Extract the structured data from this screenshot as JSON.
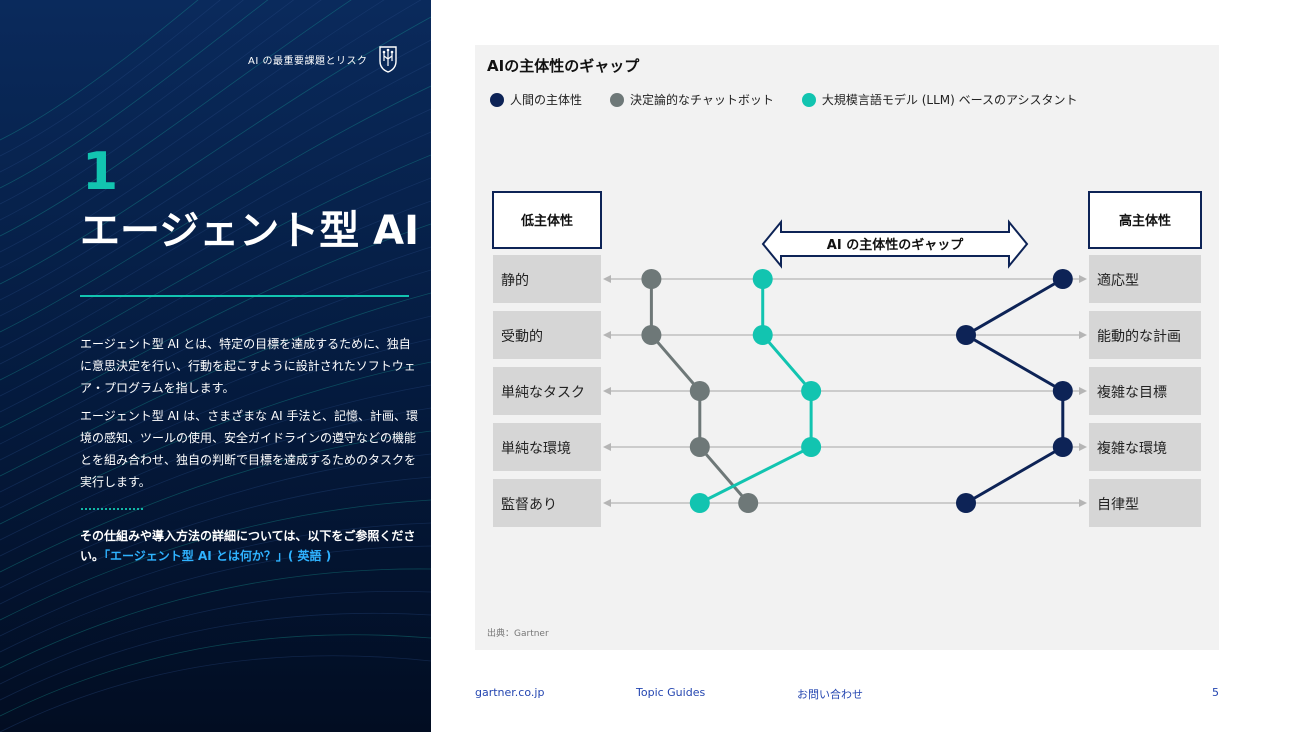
{
  "header": {
    "subtitle": "AI の最重要課題とリスク",
    "logo_icon": "shield-circuit-icon"
  },
  "section": {
    "number": "1",
    "title": "エージェント型 AI",
    "paragraph1": "エージェント型 AI とは、特定の目標を達成するために、独自に意思決定を行い、行動を起こすように設計されたソフトウェア・プログラムを指します。",
    "paragraph2": "エージェント型 AI は、さまざまな AI 手法と、記憶、計画、環境の感知、ツールの使用、安全ガイドラインの遵守などの機能とを組み合わせ、独自の判断で目標を達成するためのタスクを実行します。",
    "cta_text": "その仕組みや導入方法の詳細については、以下をご参照ください。",
    "cta_link": "「エージェント型 AI とは何か？」( 英語 )"
  },
  "colors": {
    "accent": "#12c4b0",
    "navy": "#0d2356",
    "gray": "#6e7878",
    "teal": "#12c4b0"
  },
  "chart_data": {
    "type": "line",
    "title": "AIの主体性のギャップ",
    "series": [
      {
        "name": "人間の主体性",
        "color": "#0d2356",
        "values": [
          0.95,
          0.75,
          0.95,
          0.95,
          0.75
        ]
      },
      {
        "name": "決定論的なチャットボット",
        "color": "#6e7878",
        "values": [
          0.1,
          0.1,
          0.2,
          0.2,
          0.3
        ]
      },
      {
        "name": "大規模言語モデル (LLM) ベースのアシスタント",
        "color": "#12c4b0",
        "values": [
          0.33,
          0.33,
          0.43,
          0.43,
          0.2
        ]
      }
    ],
    "left_header": "低主体性",
    "right_header": "高主体性",
    "left_labels": [
      "静的",
      "受動的",
      "単純なタスク",
      "単純な環境",
      "監督あり"
    ],
    "right_labels": [
      "適応型",
      "能動的な計画",
      "複雑な目標",
      "複雑な環境",
      "自律型"
    ],
    "gap_label": "AI の主体性のギャップ",
    "source": "出典：Gartner"
  },
  "footer": {
    "site": "gartner.co.jp",
    "guides": "Topic Guides",
    "contact": "お問い合わせ",
    "page": "5"
  }
}
